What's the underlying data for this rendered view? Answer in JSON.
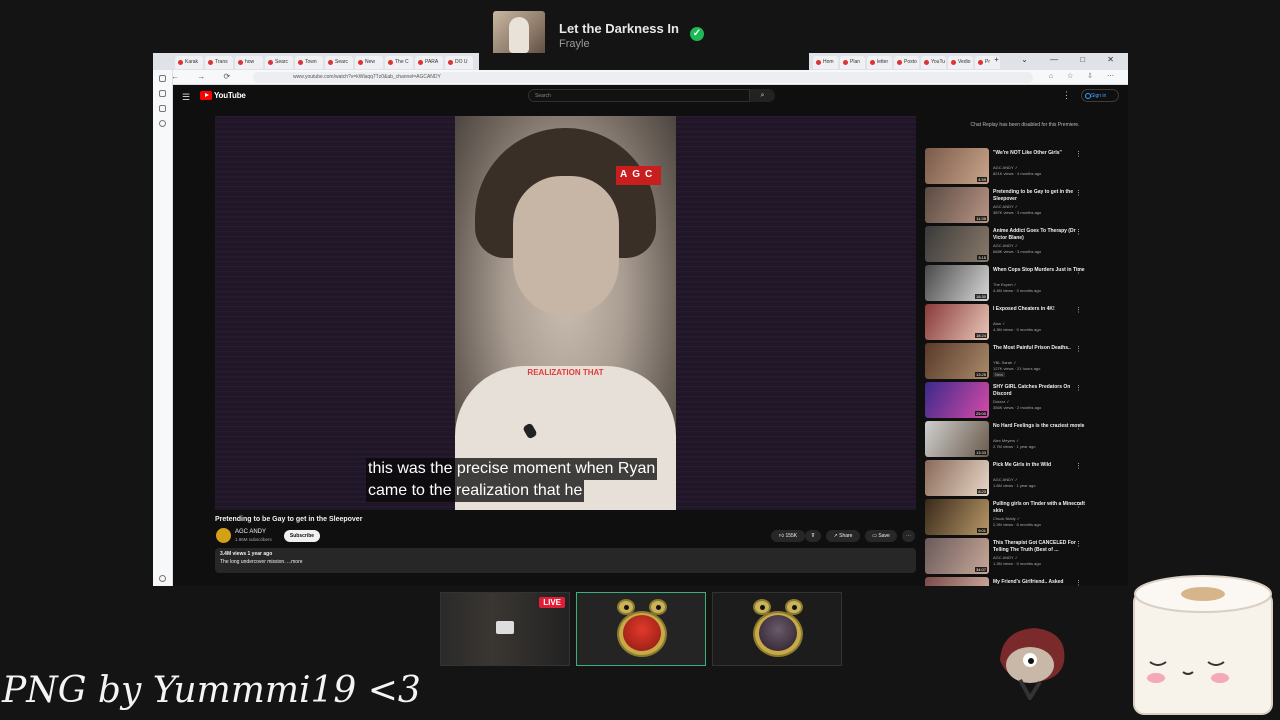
{
  "now_playing": {
    "title": "Let the Darkness In",
    "artist": "Frayle",
    "status_icon": "check-circle-icon",
    "status_color": "#1db954"
  },
  "browser": {
    "tabs_left": [
      "Karak",
      "Trans",
      "how",
      "Searc",
      "Town",
      "Searc",
      "New",
      "The C",
      "PARA",
      "DO U"
    ],
    "tabs_right": [
      "Hom",
      "Plan",
      "letter",
      "Posto",
      "YouTu",
      "Vedio",
      "Pr"
    ],
    "url": "www.youtube.com/watch?v=kWlaqq7Tz0&ab_channel=AGCANDY",
    "window_controls": [
      "+",
      "⌄",
      "—",
      "□",
      "✕"
    ]
  },
  "youtube": {
    "logo_text": "YouTube",
    "search_placeholder": "Search",
    "sign_in": "Sign in",
    "chat_note": "Chat Replay has been disabled for this Premiere.",
    "player": {
      "badge": "AGC",
      "overlay_caption": "REALIZATION THAT",
      "captions": [
        "this was the precise moment when Ryan",
        "came to the realization that he"
      ]
    },
    "video": {
      "title": "Pretending to be Gay to get in the Sleepover",
      "channel": "AGC ANDY",
      "subscribers": "1.96M subscribers",
      "subscribe_label": "Subscribe",
      "likes": "155K",
      "share_label": "Share",
      "save_label": "Save",
      "views_date": "3.4M views  1 year ago",
      "description": "The long undercover mission. ...more"
    },
    "recommendations": [
      {
        "title": "\"We're NOT Like Other Girls\"",
        "channel": "AGC ANDY",
        "meta": "821K views · 4 months ago",
        "duration": "4:59",
        "colors": [
          "#7a5a4a",
          "#c9a58a"
        ]
      },
      {
        "title": "Pretending to be Gay to get in the Sleepover",
        "channel": "AGC ANDY",
        "meta": "387K views · 3 months ago",
        "duration": "11:35",
        "colors": [
          "#5a4a42",
          "#b99584"
        ]
      },
      {
        "title": "Anime Addict Goes To Therapy (Dr Victor Blane)",
        "channel": "AGC ANDY",
        "meta": "668K views · 3 months ago",
        "duration": "3:15",
        "colors": [
          "#3a3a3a",
          "#8a7a6a"
        ]
      },
      {
        "title": "When Cops Stop Murders Just in Time",
        "channel": "The Expert",
        "meta": "4.4M views · 3 months ago",
        "duration": "18:30",
        "colors": [
          "#4a4a4a",
          "#d8d8d8"
        ]
      },
      {
        "title": "I Exposed Cheaters in 4K!",
        "channel": "Alan",
        "meta": "4.3M views · 5 months ago",
        "duration": "18:24",
        "colors": [
          "#8a3a3a",
          "#e8c8b8"
        ]
      },
      {
        "title": "The Most Painful Prison Deaths..",
        "channel": "YBL Sarah",
        "meta": "127K views · 21 hours ago",
        "duration": "13:25",
        "badge": "New",
        "colors": [
          "#5a3a2a",
          "#a88a6a"
        ]
      },
      {
        "title": "SHY GIRL Catches Predators On Discord",
        "channel": "Dotzzz",
        "meta": "356K views · 2 months ago",
        "duration": "25:00",
        "colors": [
          "#3a2a8a",
          "#d84aa8"
        ]
      },
      {
        "title": "No Hard Feelings is the craziest movie",
        "channel": "Alex Meyers",
        "meta": "2.7M views · 1 year ago",
        "duration": "13:33",
        "colors": [
          "#cfcfcf",
          "#6a5a4a"
        ]
      },
      {
        "title": "Pick Me Girls in the Wild",
        "channel": "AGC ANDY",
        "meta": "1.6M views · 1 year ago",
        "duration": "8:23",
        "colors": [
          "#8a6a5a",
          "#e8d8c8"
        ]
      },
      {
        "title": "Pulling girls on Tinder with a Minecraft skin",
        "channel": "Chuck Niddy",
        "meta": "2.2M views · 8 months ago",
        "duration": "9:01",
        "colors": [
          "#3a2a1a",
          "#b89868"
        ]
      },
      {
        "title": "This Therapist Got CANCELED For Telling The Truth (Best of ...",
        "channel": "AGC ANDY",
        "meta": "1.3M views · 5 months ago",
        "duration": "34:07",
        "colors": [
          "#6a5a5a",
          "#c8a898"
        ]
      },
      {
        "title": "My Friend's Girlfriend.. Asked",
        "channel": "",
        "meta": "",
        "duration": "",
        "colors": [
          "#7a4a4a",
          "#d8b8a8"
        ]
      }
    ]
  },
  "stream": {
    "live_label": "LIVE",
    "live_color": "#e01e37",
    "active_border_color": "#3bb07a",
    "watermark": "PNG by Yummmi19 <3"
  }
}
